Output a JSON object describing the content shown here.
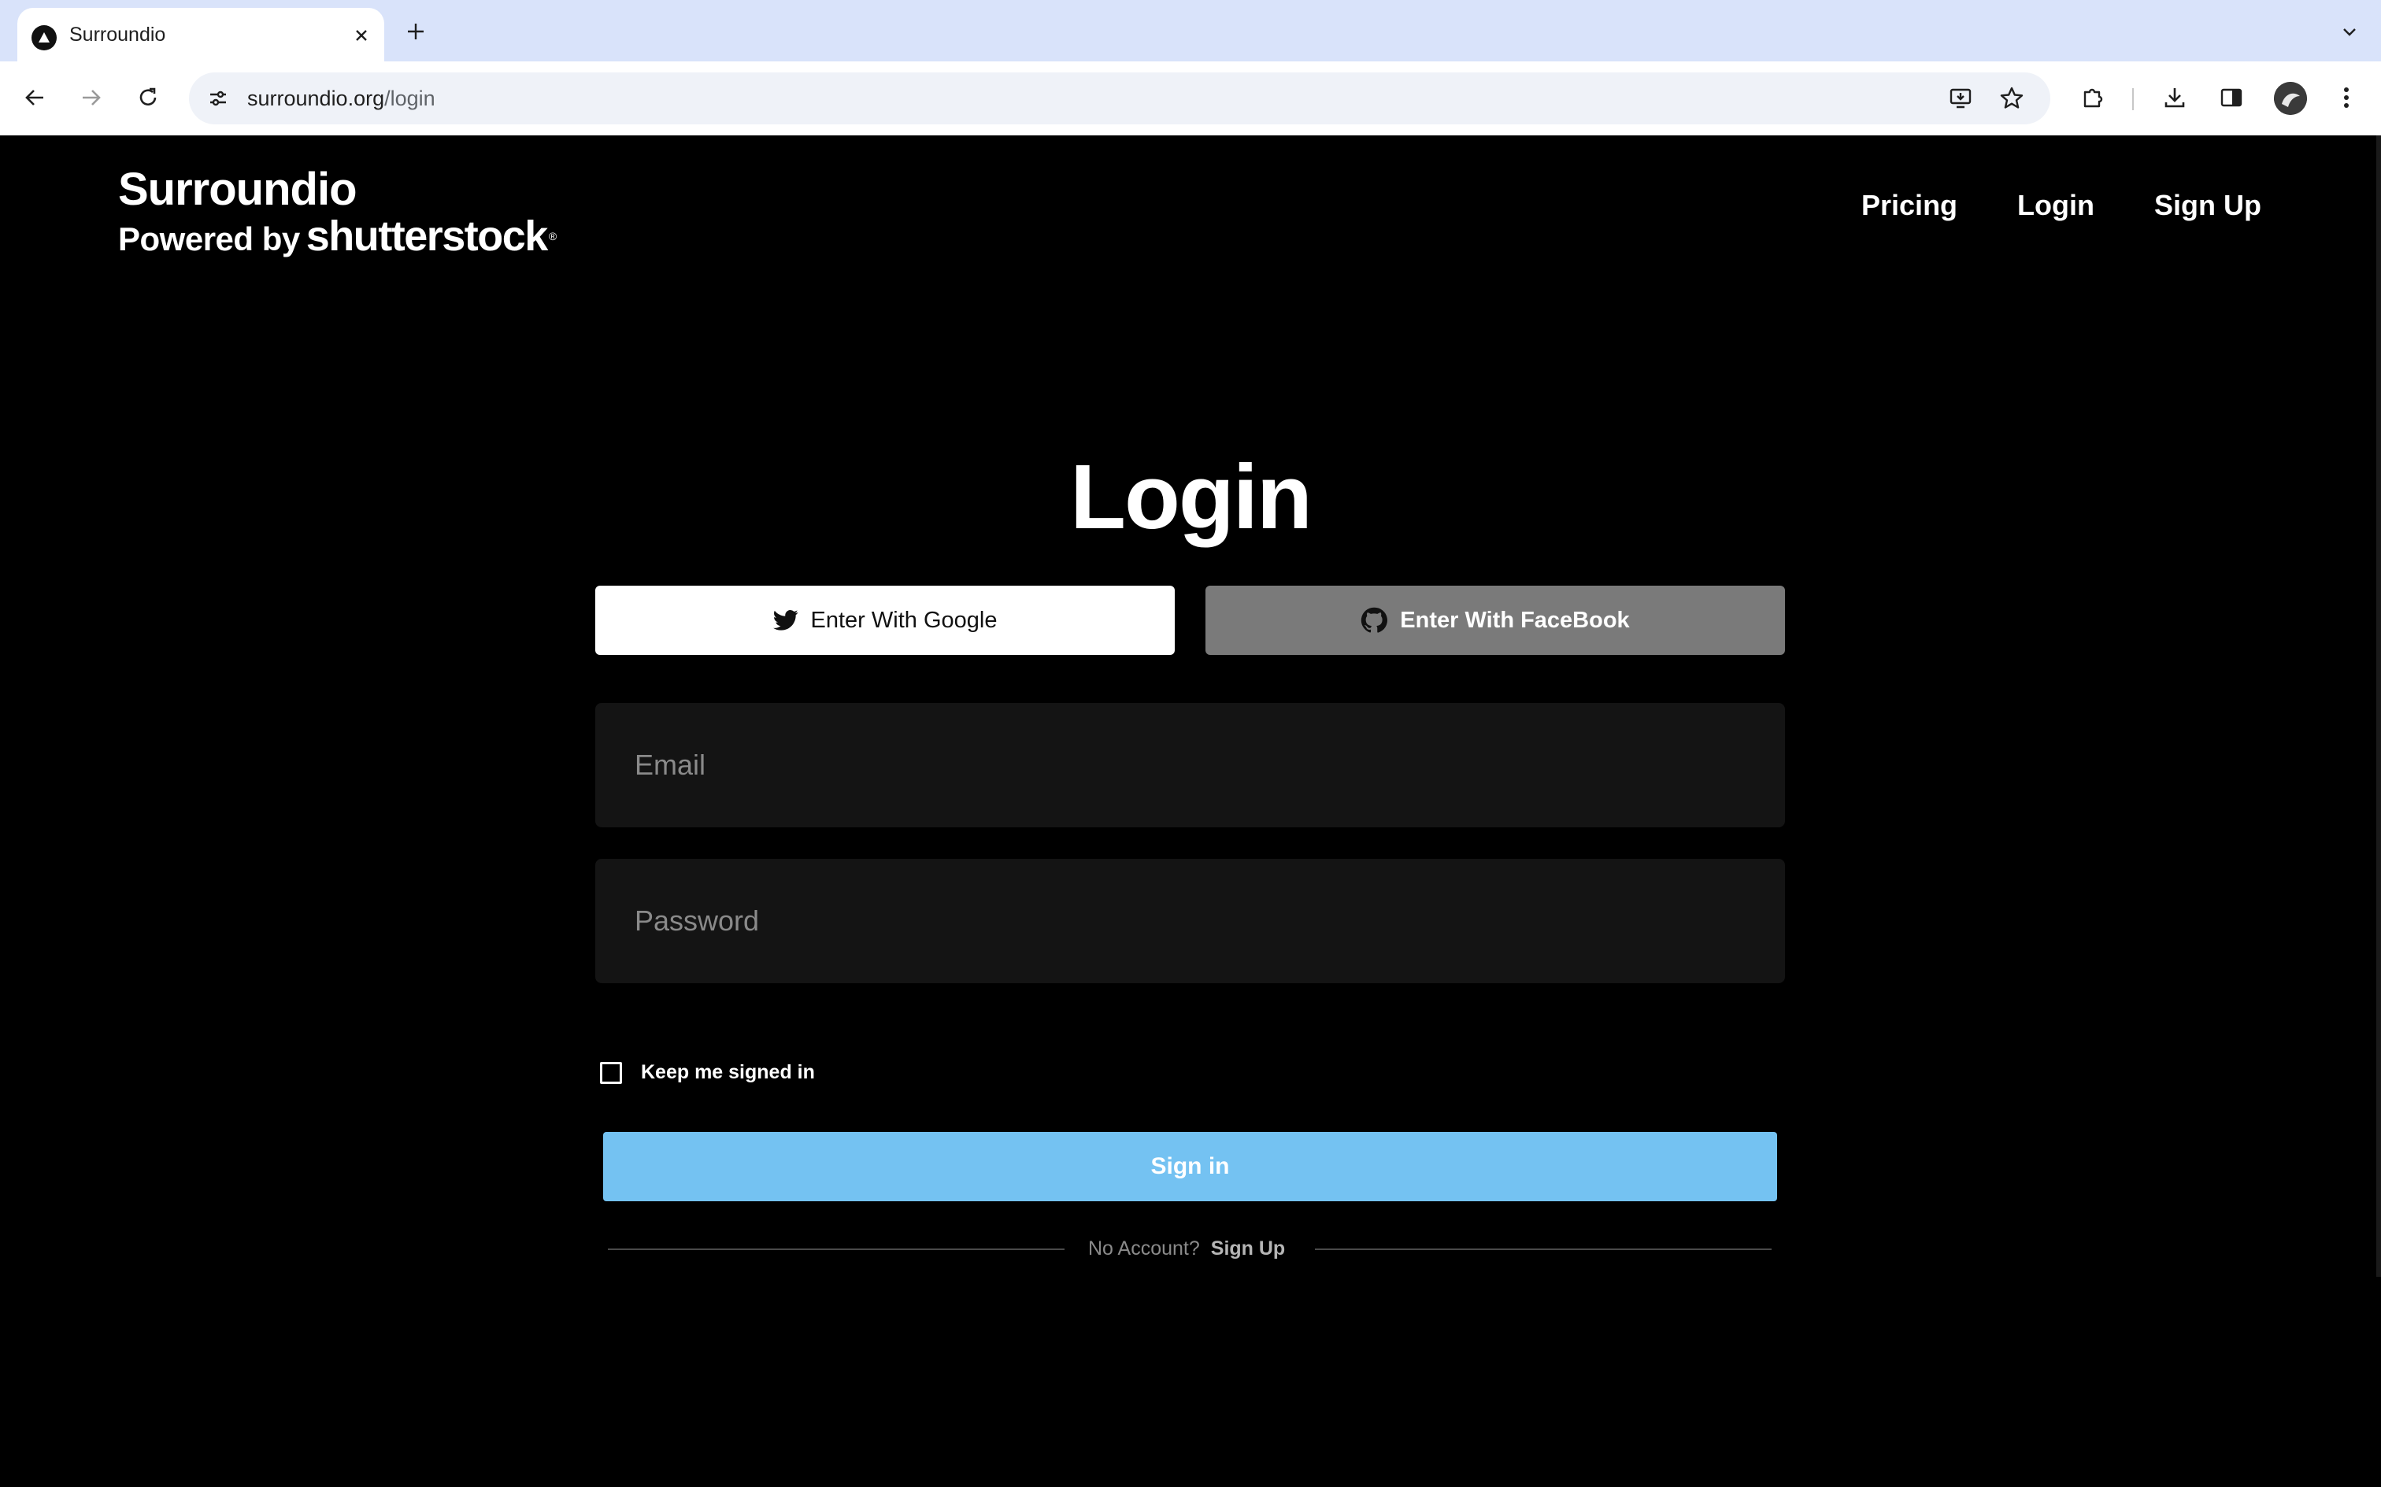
{
  "browser": {
    "tab_title": "Surroundio",
    "url_domain": "surroundio.org",
    "url_path": "/login"
  },
  "header": {
    "brand_name": "Surroundio",
    "brand_powered": "Powered by",
    "brand_partner": "shutterstock",
    "nav": {
      "pricing": "Pricing",
      "login": "Login",
      "signup": "Sign Up"
    }
  },
  "login": {
    "title": "Login",
    "google_label": "Enter With Google",
    "facebook_label": "Enter With FaceBook",
    "email_placeholder": "Email",
    "password_placeholder": "Password",
    "keep_signed_in": "Keep me signed in",
    "signin_label": "Sign in",
    "no_account": "No Account?",
    "signup_link": "Sign Up"
  },
  "colors": {
    "signin_button": "#74c2f2",
    "facebook_button": "#7a7a7a",
    "page_background": "#000000",
    "input_background": "#141414"
  }
}
